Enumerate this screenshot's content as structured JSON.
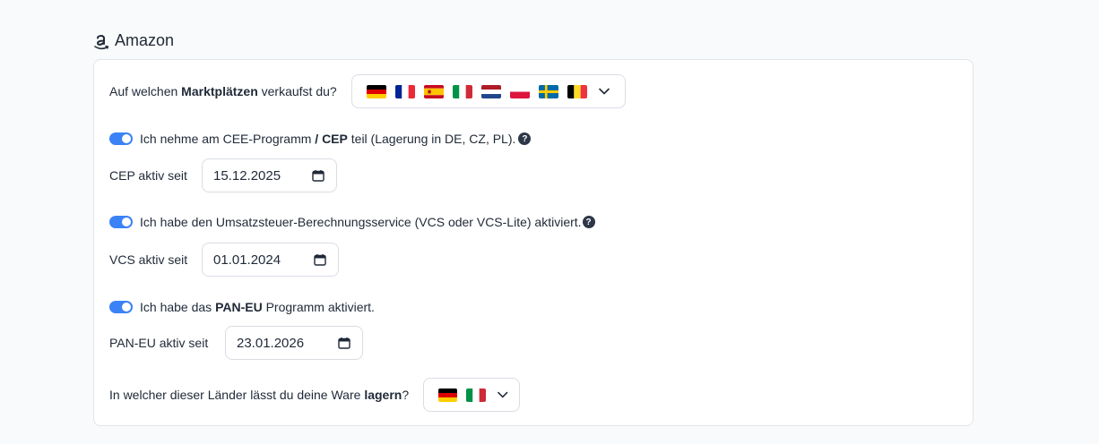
{
  "section": {
    "title": "Amazon"
  },
  "marketplaces": {
    "question_prefix": "Auf welchen ",
    "question_bold": "Marktplätzen",
    "question_suffix": " verkaufst du?",
    "flags": [
      "de-flag-icon",
      "fr-flag-icon",
      "es-flag-icon",
      "it-flag-icon",
      "nl-flag-icon",
      "pl-flag-icon",
      "se-flag-icon",
      "be-flag-icon"
    ]
  },
  "cep": {
    "toggle_on": true,
    "label_prefix": "Ich nehme am CEE-Programm ",
    "label_bold": "/ CEP",
    "label_suffix": " teil (Lagerung in DE, CZ, PL).",
    "help": "?",
    "since_label": "CEP aktiv seit",
    "since_value": "15.12.2025"
  },
  "vcs": {
    "toggle_on": true,
    "label": "Ich habe den Umsatzsteuer-Berechnungsservice (VCS oder VCS-Lite) aktiviert.",
    "help": "?",
    "since_label": "VCS aktiv seit",
    "since_value": "01.01.2024"
  },
  "paneu": {
    "toggle_on": true,
    "label_prefix": "Ich habe das ",
    "label_bold": "PAN-EU",
    "label_suffix": " Programm aktiviert.",
    "since_label": "PAN-EU aktiv seit",
    "since_value": "23.01.2026"
  },
  "storage": {
    "question_prefix": "In welcher dieser Länder lässt du deine Ware ",
    "question_bold": "lagern",
    "question_suffix": "?",
    "flags": [
      "de-flag-icon",
      "it-flag-icon"
    ]
  },
  "colors": {
    "accent": "#3b82f6",
    "help_bg": "#2d3748"
  }
}
